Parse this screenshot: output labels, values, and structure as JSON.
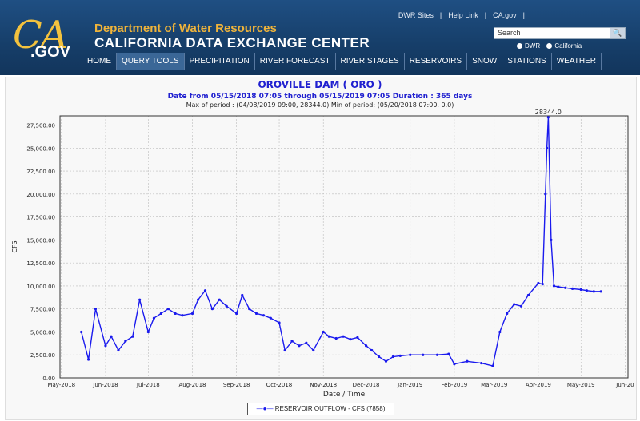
{
  "header": {
    "logo_text_ca": "CA",
    "logo_text_gov": ".GOV",
    "department": "Department of Water Resources",
    "center": "CALIFORNIA DATA EXCHANGE CENTER",
    "top_links": [
      "DWR Sites",
      "|",
      "Help Link",
      "|",
      "CA.gov",
      "|"
    ],
    "search_placeholder": "Search",
    "radio_dwr": "DWR",
    "radio_california": "California"
  },
  "nav": [
    "HOME",
    "QUERY TOOLS",
    "PRECIPITATION",
    "RIVER FORECAST",
    "RIVER STAGES",
    "RESERVOIRS",
    "SNOW",
    "STATIONS",
    "WEATHER"
  ],
  "colors": {
    "header_bg": "#163e69",
    "series": "#1a1aee",
    "title_blue": "#2020d0"
  },
  "chart_data": {
    "type": "line",
    "title": "OROVILLE DAM ( ORO )",
    "subtitle": "Date from 05/15/2018 07:05 through 05/15/2019 07:05 Duration : 365 days",
    "stats": "Max of period : (04/08/2019 09:00, 28344.0)  Min of period: (05/20/2018 07:00,  0.0)",
    "peak_annotation": "28344.0",
    "xlabel": "Date / Time",
    "ylabel": "CFS",
    "ylim": [
      0,
      28500
    ],
    "y_ticks": [
      "0.00",
      "2,500.00",
      "5,000.00",
      "7,500.00",
      "10,000.00",
      "12,500.00",
      "15,000.00",
      "17,500.00",
      "20,000.00",
      "22,500.00",
      "25,000.00",
      "27,500.00"
    ],
    "x_ticks": [
      "May-2018",
      "Jun-2018",
      "Jul-2018",
      "Aug-2018",
      "Sep-2018",
      "Oct-2018",
      "Nov-2018",
      "Dec-2018",
      "Jan-2019",
      "Feb-2019",
      "Mar-2019",
      "Apr-2019",
      "May-2019",
      "Jun-20"
    ],
    "grid": true,
    "legend": "RESERVOIR OUTFLOW - CFS (7858)",
    "legend_position": "bottom-center",
    "series": [
      {
        "name": "RESERVOIR OUTFLOW - CFS (7858)",
        "x": [
          "2018-05-15",
          "2018-05-20",
          "2018-05-25",
          "2018-06-01",
          "2018-06-05",
          "2018-06-10",
          "2018-06-15",
          "2018-06-20",
          "2018-06-25",
          "2018-07-01",
          "2018-07-05",
          "2018-07-10",
          "2018-07-15",
          "2018-07-20",
          "2018-07-25",
          "2018-08-01",
          "2018-08-05",
          "2018-08-10",
          "2018-08-15",
          "2018-08-20",
          "2018-08-25",
          "2018-09-01",
          "2018-09-05",
          "2018-09-10",
          "2018-09-15",
          "2018-09-20",
          "2018-09-25",
          "2018-10-01",
          "2018-10-05",
          "2018-10-10",
          "2018-10-15",
          "2018-10-20",
          "2018-10-25",
          "2018-11-01",
          "2018-11-05",
          "2018-11-10",
          "2018-11-15",
          "2018-11-20",
          "2018-11-25",
          "2018-12-01",
          "2018-12-05",
          "2018-12-10",
          "2018-12-15",
          "2018-12-20",
          "2018-12-25",
          "2019-01-01",
          "2019-01-10",
          "2019-01-20",
          "2019-01-28",
          "2019-02-01",
          "2019-02-10",
          "2019-02-20",
          "2019-02-28",
          "2019-03-05",
          "2019-03-10",
          "2019-03-15",
          "2019-03-20",
          "2019-03-25",
          "2019-04-01",
          "2019-04-04",
          "2019-04-06",
          "2019-04-07",
          "2019-04-08",
          "2019-04-10",
          "2019-04-12",
          "2019-04-15",
          "2019-04-20",
          "2019-04-25",
          "2019-05-01",
          "2019-05-05",
          "2019-05-10",
          "2019-05-15"
        ],
        "values": [
          5000,
          2000,
          7500,
          3500,
          4500,
          3000,
          4000,
          4500,
          8500,
          5000,
          6500,
          7000,
          7500,
          7000,
          6800,
          7000,
          8500,
          9500,
          7500,
          8500,
          7800,
          7000,
          9000,
          7500,
          7000,
          6800,
          6500,
          6000,
          3000,
          4000,
          3500,
          3800,
          3000,
          5000,
          4500,
          4300,
          4500,
          4200,
          4400,
          3500,
          3000,
          2300,
          1800,
          2300,
          2400,
          2500,
          2500,
          2500,
          2600,
          1500,
          1800,
          1600,
          1300,
          5000,
          7000,
          8000,
          7800,
          9000,
          10300,
          10200,
          20000,
          25000,
          28344,
          15000,
          10000,
          9900,
          9800,
          9700,
          9600,
          9500,
          9400,
          9400
        ]
      }
    ]
  }
}
